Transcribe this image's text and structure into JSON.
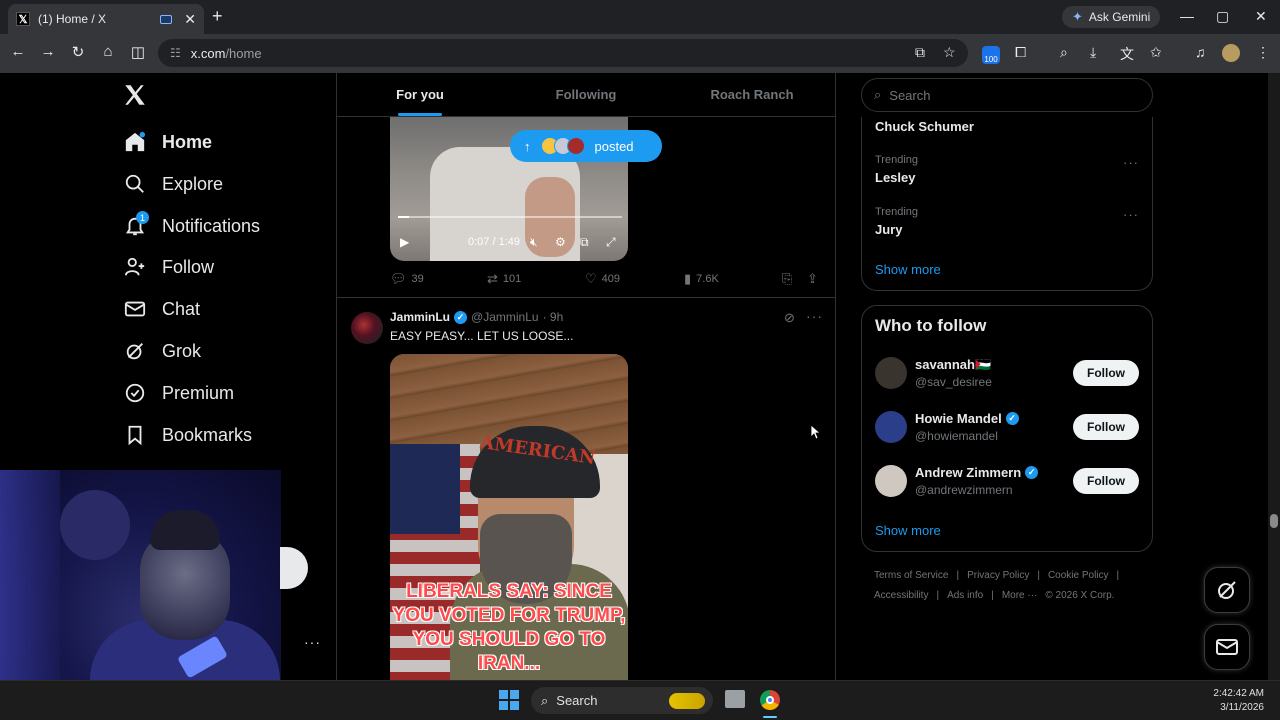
{
  "browser": {
    "tab_title": "(1) Home / X",
    "new_tab": "+",
    "gemini_label": "Ask Gemini",
    "url_host": "x.com",
    "url_path": "/home",
    "extension_badge": "100",
    "window_controls": [
      "—",
      "▢",
      "✕"
    ]
  },
  "nav": {
    "items": [
      {
        "label": "Home",
        "icon": "home-icon"
      },
      {
        "label": "Explore",
        "icon": "search-icon"
      },
      {
        "label": "Notifications",
        "icon": "bell-icon",
        "badge": "1"
      },
      {
        "label": "Follow",
        "icon": "person-plus-icon"
      },
      {
        "label": "Chat",
        "icon": "envelope-icon"
      },
      {
        "label": "Grok",
        "icon": "grok-icon"
      },
      {
        "label": "Premium",
        "icon": "verified-icon"
      },
      {
        "label": "Bookmarks",
        "icon": "bookmark-icon"
      }
    ],
    "more_dots": "···"
  },
  "feed": {
    "tabs": [
      "For you",
      "Following",
      "Roach Ranch"
    ],
    "posted_pill": "posted",
    "video1": {
      "time": "0:07 / 1:49",
      "progress_fraction": 0.05
    },
    "tweet1_actions": {
      "replies": "39",
      "reposts": "101",
      "likes": "409",
      "views": "7.6K"
    },
    "tweet2": {
      "name": "JamminLu",
      "handle": "@JamminLu",
      "time": "· 9h",
      "text": "EASY PEASY... LET US LOOSE...",
      "cap_text": "AMERICAN",
      "caption": "LIBERALS SAY: SINCE YOU VOTED FOR TRUMP, YOU SHOULD GO TO IRAN..."
    }
  },
  "right": {
    "search_placeholder": "Search",
    "trends": [
      {
        "label": "",
        "name": "Chuck Schumer"
      },
      {
        "label": "Trending",
        "name": "Lesley"
      },
      {
        "label": "Trending",
        "name": "Jury"
      }
    ],
    "show_more": "Show more",
    "who_to_follow": {
      "title": "Who to follow",
      "users": [
        {
          "name": "savannah🇵🇸",
          "handle": "@sav_desiree",
          "verified": false,
          "avatar_color": "#3a342e"
        },
        {
          "name": "Howie Mandel",
          "handle": "@howiemandel",
          "verified": true,
          "avatar_color": "#2b3e8a"
        },
        {
          "name": "Andrew Zimmern",
          "handle": "@andrewzimmern",
          "verified": true,
          "avatar_color": "#cfc8c0"
        }
      ],
      "follow_label": "Follow",
      "show_more": "Show more"
    },
    "footer": {
      "row1": [
        "Terms of Service",
        "|",
        "Privacy Policy",
        "|",
        "Cookie Policy",
        "|"
      ],
      "row2": [
        "Accessibility",
        "|",
        "Ads info",
        "|",
        "More ···",
        "© 2026 X Corp."
      ]
    }
  },
  "taskbar": {
    "search_label": "Search",
    "time": "2:42:42 AM",
    "date": "3/11/2026"
  }
}
